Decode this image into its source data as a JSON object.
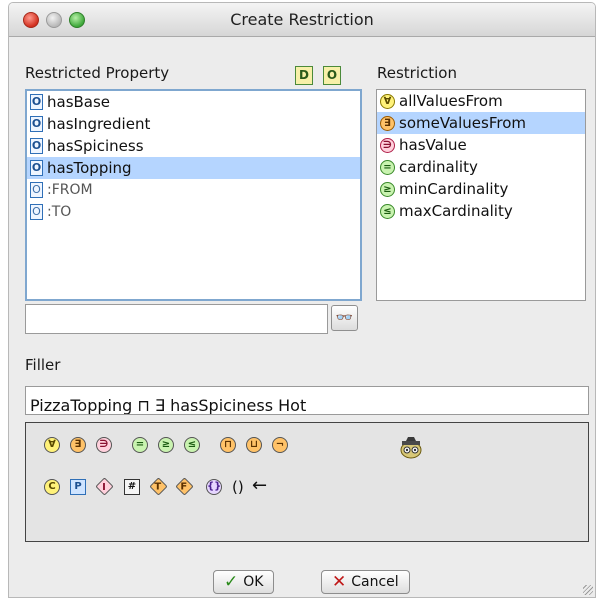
{
  "window": {
    "title": "Create Restriction"
  },
  "restricted_property": {
    "label": "Restricted Property",
    "items": [
      {
        "icon": "O",
        "label": "hasBase",
        "selected": false
      },
      {
        "icon": "O",
        "label": "hasIngredient",
        "selected": false
      },
      {
        "icon": "O",
        "label": "hasSpiciness",
        "selected": false
      },
      {
        "icon": "O",
        "label": "hasTopping",
        "selected": true
      },
      {
        "icon": "O",
        "label": ":FROM",
        "selected": false
      },
      {
        "icon": "O",
        "label": ":TO",
        "selected": false
      }
    ],
    "header_buttons": [
      "D",
      "O"
    ],
    "search": {
      "value": "",
      "placeholder": ""
    }
  },
  "restriction": {
    "label": "Restriction",
    "items": [
      {
        "symbol": "∀",
        "label": "allValuesFrom",
        "selected": false
      },
      {
        "symbol": "∃",
        "label": "someValuesFrom",
        "selected": true
      },
      {
        "symbol": "∋",
        "label": "hasValue",
        "selected": false
      },
      {
        "symbol": "=",
        "label": "cardinality",
        "selected": false
      },
      {
        "symbol": "≥",
        "label": "minCardinality",
        "selected": false
      },
      {
        "symbol": "≤",
        "label": "maxCardinality",
        "selected": false
      }
    ]
  },
  "filler": {
    "label": "Filler",
    "value": "PizzaTopping ⊓ ∃ hasSpiciness Hot"
  },
  "palette": {
    "row1": [
      "∀",
      "∃",
      "∋",
      "=",
      "≥",
      "≤",
      "⊓",
      "⊔",
      "¬"
    ],
    "row2": [
      "C",
      "P",
      "I",
      "#",
      "T",
      "F",
      "{}",
      "()",
      "←"
    ]
  },
  "buttons": {
    "ok": "OK",
    "cancel": "Cancel"
  },
  "icons": {
    "search": "binoculars-icon",
    "wizard": "wizard-icon",
    "ok": "checkmark-icon",
    "cancel": "x-icon"
  }
}
